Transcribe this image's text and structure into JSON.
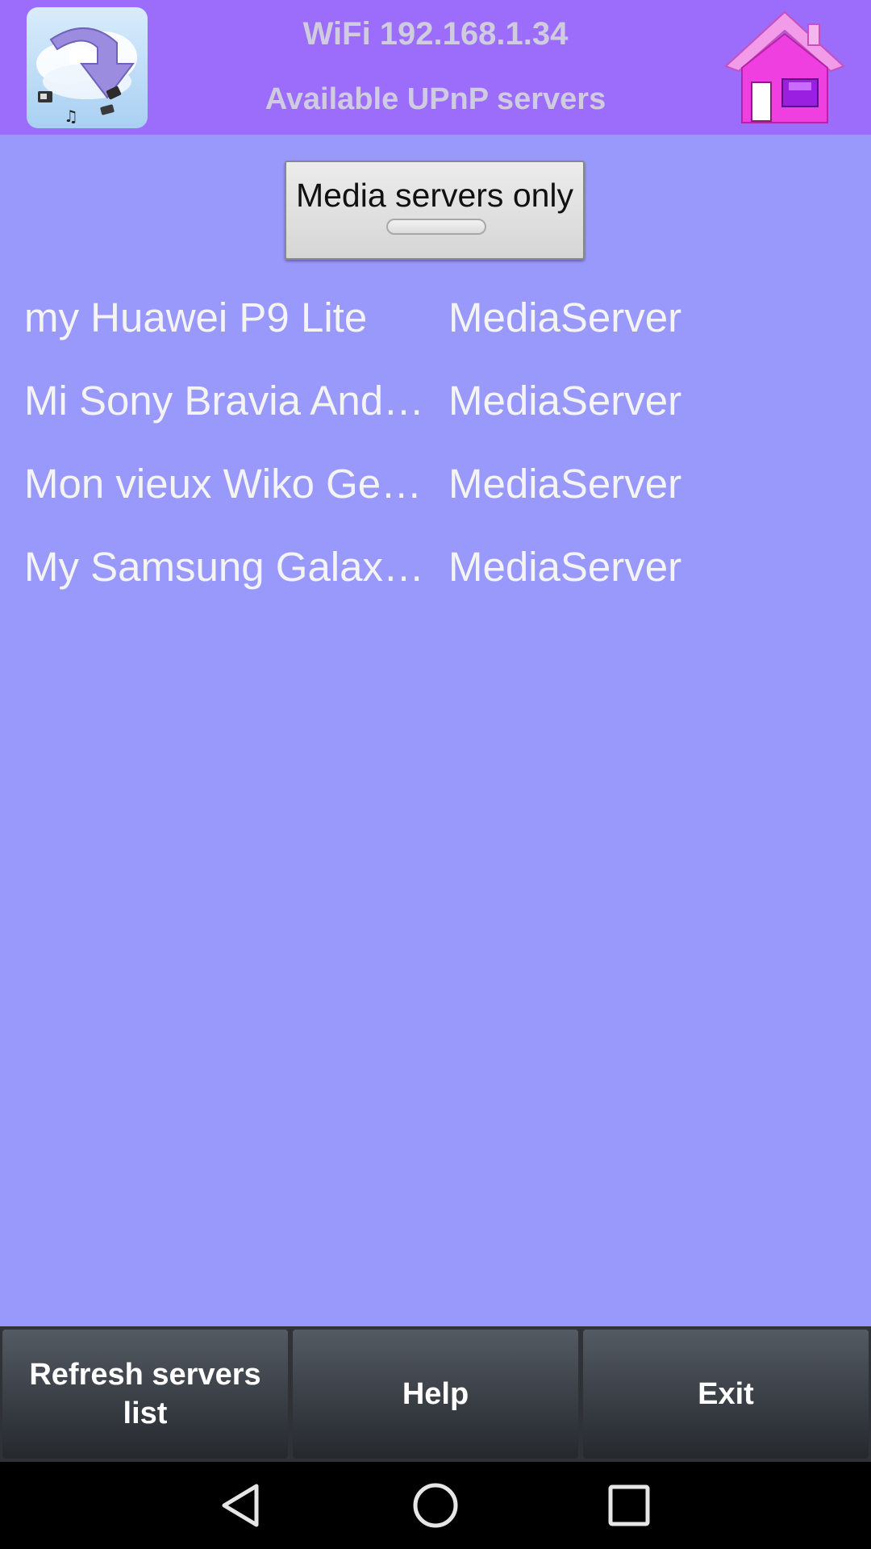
{
  "header": {
    "title": "WiFi  192.168.1.34",
    "subtitle": "Available UPnP servers",
    "app_icon": "cloud-download-media-icon",
    "home_icon": "pink-house-icon"
  },
  "filter": {
    "label": "Media servers only"
  },
  "servers": [
    {
      "name": "my Huawei P9 Lite",
      "type": "MediaServer"
    },
    {
      "name": "Mi Sony Bravia And…",
      "type": "MediaServer"
    },
    {
      "name": "Mon vieux Wiko Ge…",
      "type": "MediaServer"
    },
    {
      "name": "My Samsung Galax…",
      "type": "MediaServer"
    }
  ],
  "actions": {
    "refresh_label": "Refresh servers list",
    "help_label": "Help",
    "exit_label": "Exit"
  },
  "system_nav": {
    "back_icon": "back-triangle-icon",
    "home_icon": "home-circle-icon",
    "recents_icon": "recents-square-icon"
  },
  "colors": {
    "header_bg": "#9c6cfb",
    "content_bg": "#9999fc",
    "header_text": "#d0cce0",
    "list_text": "#f4f4f4",
    "action_bar_bg": "#2f3338",
    "nav_bar_bg": "#000000"
  }
}
